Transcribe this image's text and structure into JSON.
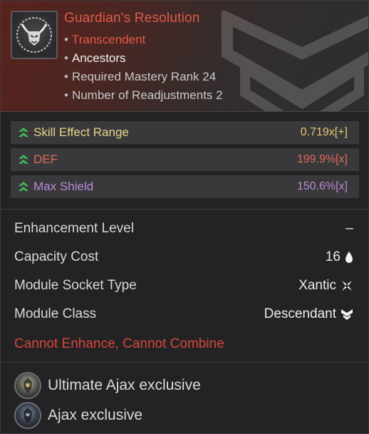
{
  "module": {
    "title": "Guardian's Resolution",
    "rarity": "Transcendent",
    "line": "Ancestors",
    "mastery": "Required Mastery Rank 24",
    "readjustments": "Number of Readjustments 2",
    "icon": "horned-helmet-emblem-icon"
  },
  "stats": [
    {
      "name": "Skill Effect Range",
      "value": "0.719x[+]",
      "color": "#e8d48a"
    },
    {
      "name": "DEF",
      "value": "199.9%[x]",
      "color": "#e06a58"
    },
    {
      "name": "Max Shield",
      "value": "150.6%[x]",
      "color": "#b98ad8"
    }
  ],
  "info": {
    "enhancement_label": "Enhancement Level",
    "enhancement_value": "–",
    "capacity_label": "Capacity Cost",
    "capacity_value": "16",
    "socket_label": "Module Socket Type",
    "socket_value": "Xantic",
    "class_label": "Module Class",
    "class_value": "Descendant"
  },
  "warning": "Cannot Enhance, Cannot Combine",
  "exclusives": [
    {
      "label": "Ultimate Ajax exclusive"
    },
    {
      "label": "Ajax exclusive"
    }
  ],
  "colors": {
    "title": "#e05a4a",
    "warning": "#d8453a",
    "stat_arrow": "#3fbf58"
  }
}
